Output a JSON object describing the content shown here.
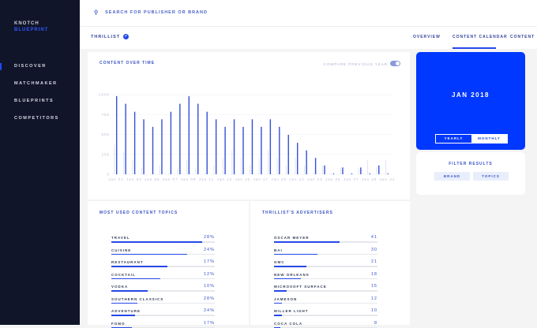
{
  "sidebar": {
    "brand_top": "KNOTCH",
    "brand_bottom": "BLUEPRINT",
    "items": [
      {
        "label": "DISCOVER"
      },
      {
        "label": "MATCHMAKER"
      },
      {
        "label": "BLUEPRINTS"
      },
      {
        "label": "COMPETITORS"
      }
    ]
  },
  "search": {
    "placeholder": "SEARCH FOR PUBLISHER OR BRAND"
  },
  "header": {
    "publisher": "THRILLIST",
    "tabs": [
      {
        "label": "OVERVIEW"
      },
      {
        "label": "CONTENT CALENDAR"
      },
      {
        "label": "CONTENT"
      }
    ]
  },
  "chart_card": {
    "title": "CONTENT OVER TIME",
    "compare_label": "COMPARE PREVIOUS YEAR",
    "compare_on": true
  },
  "chart_data": {
    "type": "bar",
    "title": "CONTENT OVER TIME",
    "ylim": [
      0,
      1000
    ],
    "yticks": [
      "1000",
      "750",
      "500",
      "250",
      "0"
    ],
    "xticklabels": [
      "Jan 01",
      "Jan 03",
      "Jan 05",
      "Jan 07",
      "Jan 09",
      "Jan 11",
      "Jan 13",
      "Jan 15",
      "Jan 17",
      "Jan 19",
      "Jan 21",
      "Jan 23",
      "Jan 25",
      "Jan 27",
      "Jan 29",
      "Jan 31"
    ],
    "series": [
      {
        "name": "Current year",
        "color": "#3350d6",
        "values": [
          980,
          885,
          785,
          690,
          595,
          690,
          785,
          885,
          980,
          885,
          785,
          690,
          595,
          690,
          595,
          690,
          595,
          690,
          595,
          495,
          395,
          300,
          205,
          110,
          10,
          85,
          10,
          85,
          10,
          110,
          10
        ]
      },
      {
        "name": "Previous year",
        "color": "#dfe3f3",
        "values": [
          370,
          275,
          180,
          85,
          10,
          110,
          10,
          85,
          180,
          85,
          10,
          110,
          205,
          300,
          205,
          110,
          205,
          300,
          205,
          110,
          205,
          110,
          10,
          110,
          10,
          85,
          10,
          85,
          180,
          85,
          180
        ]
      }
    ]
  },
  "topics": {
    "title": "MOST USED CONTENT TOPICS",
    "items": [
      {
        "label": "TRAVEL",
        "value": "28%",
        "fill": 0.88
      },
      {
        "label": "CUISINE",
        "value": "24%",
        "fill": 0.73
      },
      {
        "label": "RESTAURANT",
        "value": "17%",
        "fill": 0.54
      },
      {
        "label": "COCKTAIL",
        "value": "12%",
        "fill": 0.47
      },
      {
        "label": "VODKA",
        "value": "10%",
        "fill": 0.35
      },
      {
        "label": "SOUTHERN CLASSICS",
        "value": "28%",
        "fill": 0.25
      },
      {
        "label": "ADVENTURE",
        "value": "24%",
        "fill": 0.23
      },
      {
        "label": "FOMO",
        "value": "17%",
        "fill": 0.2
      }
    ]
  },
  "advertisers": {
    "title": "THRILLIST'S ADVERTISERS",
    "items": [
      {
        "label": "OSCAR MEYER",
        "value": "41",
        "fill": 0.63
      },
      {
        "label": "BAI",
        "value": "30",
        "fill": 0.42
      },
      {
        "label": "GMC",
        "value": "21",
        "fill": 0.31
      },
      {
        "label": "NEW ORLEANS",
        "value": "18",
        "fill": 0.26
      },
      {
        "label": "MICROSOFT SURFACE",
        "value": "15",
        "fill": 0.12
      },
      {
        "label": "JAMESON",
        "value": "12",
        "fill": 0.08
      },
      {
        "label": "MILLER LIGHT",
        "value": "10",
        "fill": 0.08
      },
      {
        "label": "COCA COLA",
        "value": "8",
        "fill": 0.06
      }
    ]
  },
  "calendar": {
    "period": "JAN 2018",
    "yearly": "YEARLY",
    "monthly": "MONTHLY",
    "active": "MONTHLY"
  },
  "filter": {
    "title": "FILTER RESULTS",
    "chips": [
      "BRAND",
      "TOPICS"
    ]
  }
}
